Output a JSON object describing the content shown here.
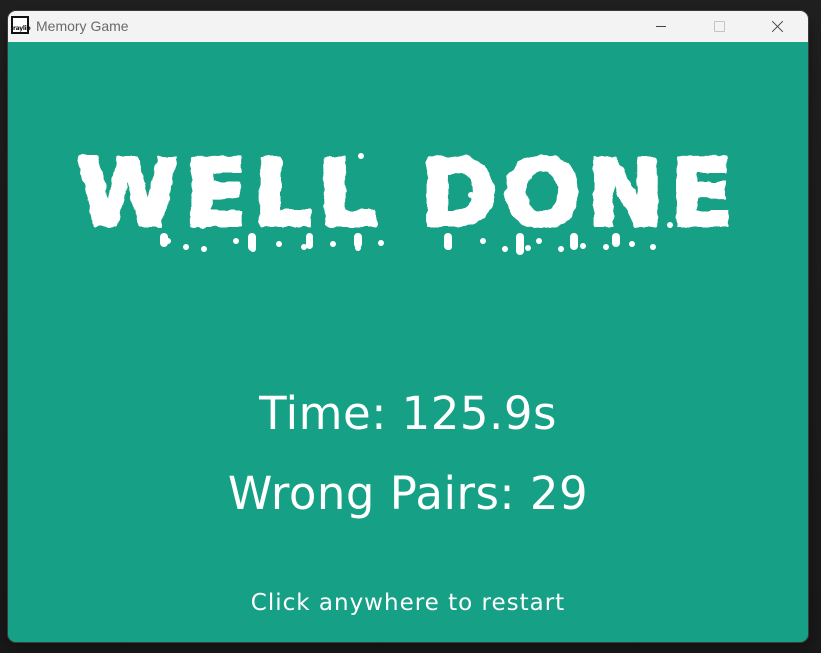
{
  "window": {
    "title": "Memory Game",
    "icon_name": "raylib-app-icon",
    "icon_text": "raylib"
  },
  "titlebar_buttons": {
    "minimize": "minimize-icon",
    "maximize": "maximize-icon",
    "close": "close-icon"
  },
  "game": {
    "headline": "WELL DONE",
    "time_line": "Time: 125.9s",
    "wrong_pairs_line": "Wrong Pairs: 29",
    "restart_hint": "Click anywhere to restart"
  },
  "colors": {
    "background": "#16a085",
    "text": "#ffffff",
    "titlebar": "#f3f3f3"
  }
}
